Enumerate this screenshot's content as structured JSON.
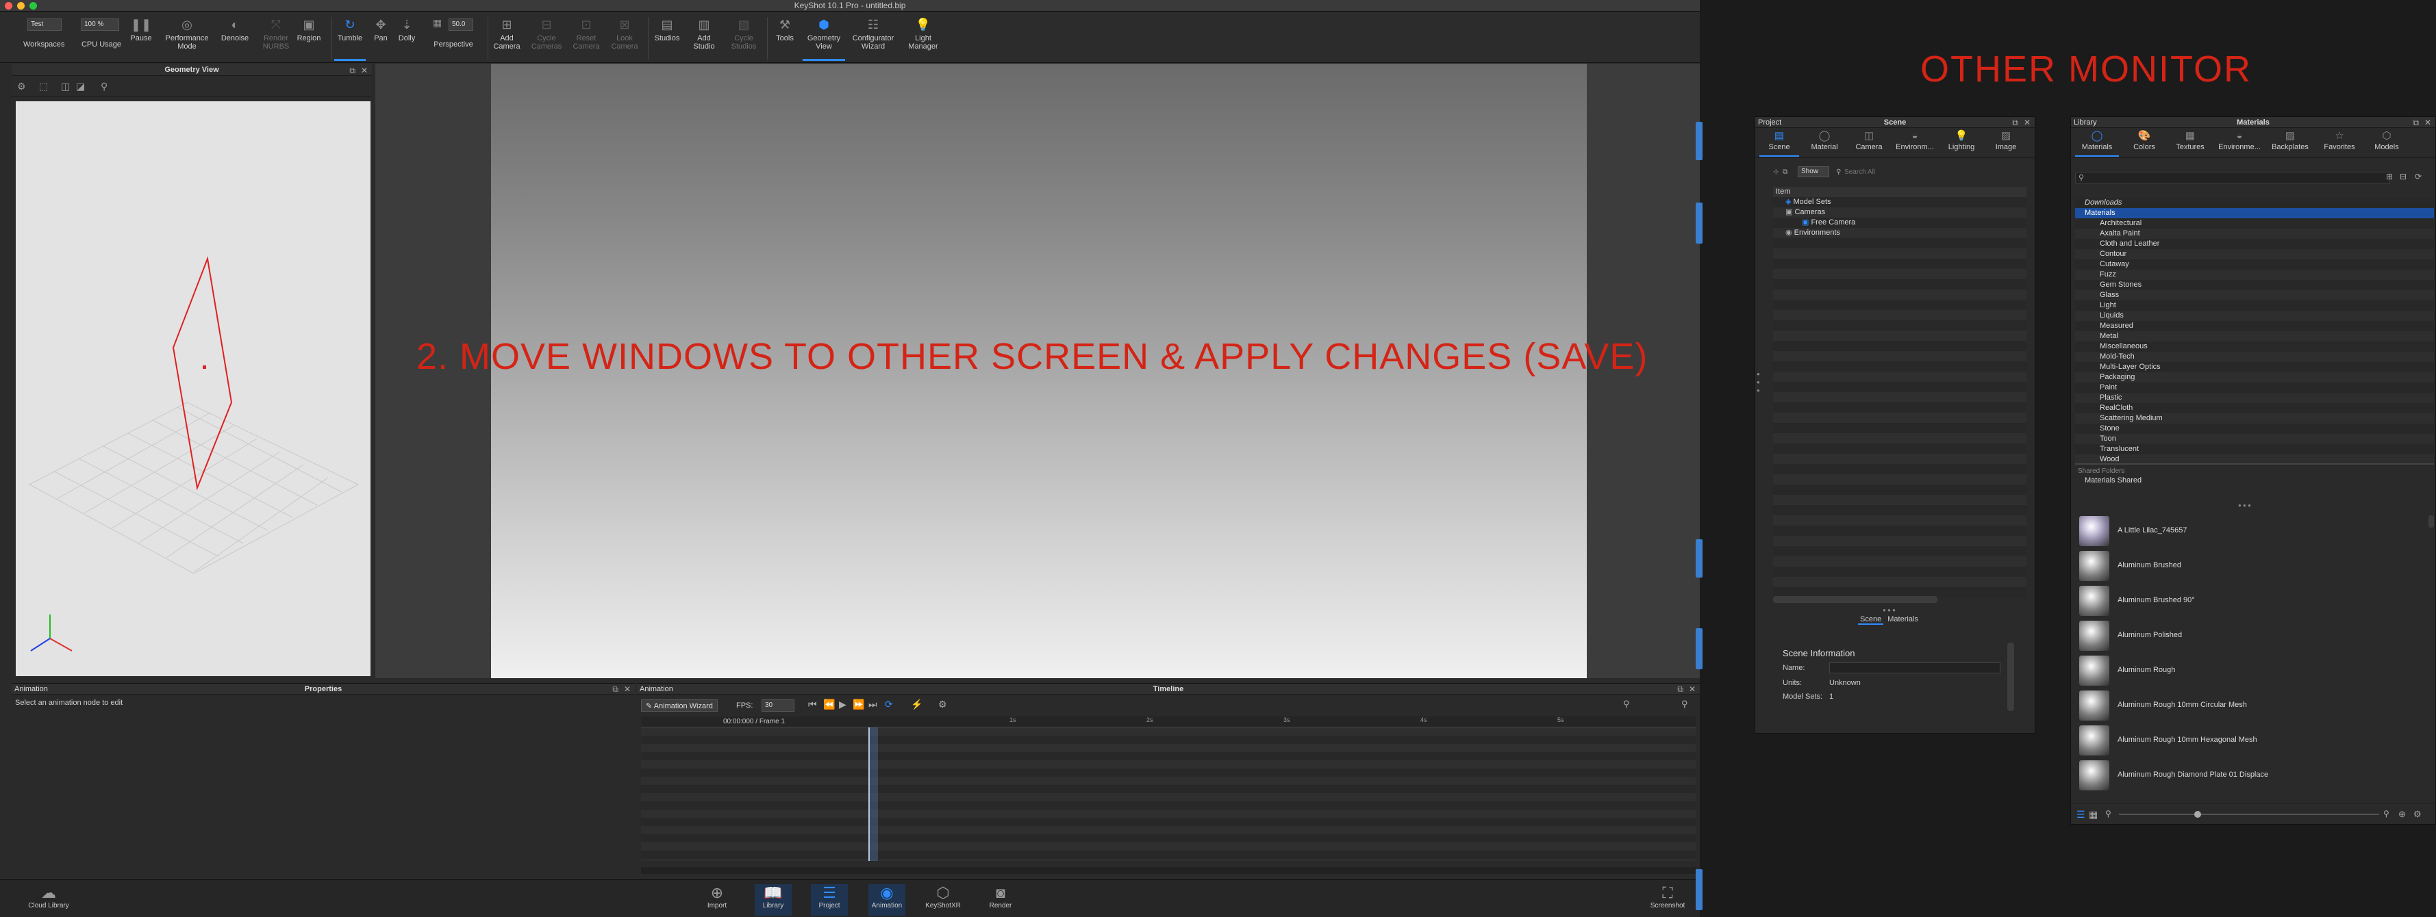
{
  "window": {
    "title": "KeyShot 10.1 Pro  - untitled.bip"
  },
  "toolbar": {
    "workspace_value": "Test",
    "cpu_value": "100 %",
    "fov_value": "50.0",
    "items": [
      {
        "label": "Workspaces",
        "icon": "workspaces-icon"
      },
      {
        "label": "CPU Usage",
        "icon": "cpu-icon"
      },
      {
        "label": "Pause",
        "icon": "pause-icon"
      },
      {
        "label": "Performance Mode",
        "icon": "performance-icon"
      },
      {
        "label": "Denoise",
        "icon": "denoise-icon"
      },
      {
        "label": "Render NURBS",
        "icon": "nurbs-icon"
      },
      {
        "label": "Region",
        "icon": "region-icon"
      },
      {
        "label": "Tumble",
        "icon": "tumble-icon"
      },
      {
        "label": "Pan",
        "icon": "pan-icon"
      },
      {
        "label": "Dolly",
        "icon": "dolly-icon"
      },
      {
        "label": "Perspective",
        "icon": "perspective-icon"
      },
      {
        "label": "Add Camera",
        "icon": "add-camera-icon"
      },
      {
        "label": "Cycle Cameras",
        "icon": "cycle-cameras-icon"
      },
      {
        "label": "Reset Camera",
        "icon": "reset-camera-icon"
      },
      {
        "label": "Look Camera",
        "icon": "look-camera-icon"
      },
      {
        "label": "Studios",
        "icon": "studios-icon"
      },
      {
        "label": "Add Studio",
        "icon": "add-studio-icon"
      },
      {
        "label": "Cycle Studios",
        "icon": "cycle-studios-icon"
      },
      {
        "label": "Tools",
        "icon": "tools-icon"
      },
      {
        "label": "Geometry View",
        "icon": "geometry-view-icon"
      },
      {
        "label": "Configurator Wizard",
        "icon": "configurator-icon"
      },
      {
        "label": "Light Manager",
        "icon": "light-manager-icon"
      }
    ]
  },
  "geometry_view": {
    "title": "Geometry View"
  },
  "overlay": {
    "instruction": "2. MOVE WINDOWS TO OTHER SCREEN & APPLY CHANGES (SAVE)",
    "other_monitor": "OTHER MONITOR"
  },
  "properties": {
    "tab": "Animation",
    "title": "Properties",
    "message": "Select an animation node to edit"
  },
  "timeline": {
    "tab": "Animation",
    "title": "Timeline",
    "wizard": "Animation Wizard",
    "fps_label": "FPS:",
    "fps_value": "30",
    "time": "00:00:000 / Frame 1",
    "ticks": [
      "1s",
      "2s",
      "3s",
      "4s",
      "5s"
    ]
  },
  "dock": {
    "items": [
      {
        "label": "Cloud Library",
        "icon": "cloud-icon"
      },
      {
        "label": "Import",
        "icon": "import-icon"
      },
      {
        "label": "Library",
        "icon": "library-icon"
      },
      {
        "label": "Project",
        "icon": "project-icon"
      },
      {
        "label": "Animation",
        "icon": "animation-icon"
      },
      {
        "label": "KeyShotXR",
        "icon": "keyshotxr-icon"
      },
      {
        "label": "Render",
        "icon": "render-icon"
      },
      {
        "label": "Screenshot",
        "icon": "screenshot-icon"
      }
    ]
  },
  "project": {
    "tab": "Project",
    "title": "Scene",
    "tabs": [
      "Scene",
      "Material",
      "Camera",
      "Environm...",
      "Lighting",
      "Image"
    ],
    "show_label": "Show",
    "search_placeholder": "Search All",
    "column": "Item",
    "tree": [
      "Model Sets",
      "Cameras",
      "Free Camera",
      "Environments"
    ],
    "subtabs": [
      "Scene",
      "Materials"
    ],
    "info": {
      "title": "Scene Information",
      "name_label": "Name:",
      "units_label": "Units:",
      "units_value": "Unknown",
      "model_sets_label": "Model Sets:",
      "model_sets_value": "1"
    }
  },
  "library": {
    "tab": "Library",
    "title": "Materials",
    "tabs": [
      "Materials",
      "Colors",
      "Textures",
      "Environme...",
      "Backplates",
      "Favorites",
      "Models"
    ],
    "folders": [
      "Downloads",
      "Materials",
      "Architectural",
      "Axalta Paint",
      "Cloth and Leather",
      "Contour",
      "Cutaway",
      "Fuzz",
      "Gem Stones",
      "Glass",
      "Light",
      "Liquids",
      "Measured",
      "Metal",
      "Miscellaneous",
      "Mold-Tech",
      "Multi-Layer Optics",
      "Packaging",
      "Paint",
      "Plastic",
      "RealCloth",
      "Scattering Medium",
      "Stone",
      "Toon",
      "Translucent",
      "Wood"
    ],
    "shared_header": "Shared Folders",
    "shared": [
      "Materials Shared"
    ],
    "materials": [
      "A Little Lilac_745657",
      "Aluminum Brushed",
      "Aluminum Brushed 90°",
      "Aluminum Polished",
      "Aluminum Rough",
      "Aluminum Rough 10mm Circular Mesh",
      "Aluminum Rough 10mm Hexagonal Mesh",
      "Aluminum Rough Diamond Plate 01 Displace"
    ]
  },
  "colors": {
    "accent": "#2f8cff",
    "annotation": "#d42416",
    "selection": "#1c4fa0"
  }
}
